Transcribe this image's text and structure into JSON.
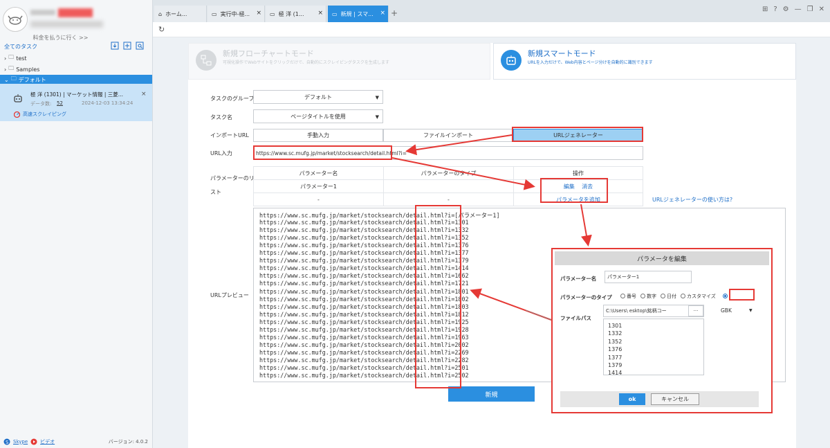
{
  "sidebar": {
    "pay_link": "料金を払うに行く >>",
    "all_tasks": "全てのタスク",
    "folders": [
      "test",
      "Samples",
      "デフォルト"
    ],
    "task": {
      "title": "極 洋 (1301) | マーケット情報 | 三菱...",
      "count_label": "データ数:",
      "count_value": "52",
      "date": "2024-12-03 13:34:24",
      "badge": "高速スクレイピング"
    },
    "footer": {
      "skype": "Skype",
      "video": "ビデオ",
      "version": "バージョン: 4.0.2"
    }
  },
  "tabs": [
    {
      "label": "ホーム...",
      "icon": "home-icon"
    },
    {
      "label": "実行中-極...",
      "icon": "page-icon"
    },
    {
      "label": "極 洋 (1...",
      "icon": "page-icon"
    },
    {
      "label": "新規 | スマ...",
      "icon": "page-icon",
      "active": true
    }
  ],
  "modes": {
    "flow": {
      "title": "新規フローチャートモード",
      "desc": "可視化操作でWebサイトをクリックだけで、自動的にスクレイピングタスクを生成します"
    },
    "smart": {
      "title": "新規スマートモード",
      "desc": "URLを入力だけで、Web内容とページ分けを自動的に識別できます"
    }
  },
  "form": {
    "group_label": "タスクのグループ",
    "group_value": "デフォルト",
    "name_label": "タスク名",
    "name_value": "ページタイトルを使用",
    "import_label": "インポートURL",
    "import_options": [
      "手動入力",
      "ファイルインポート",
      "URLジェネレーター"
    ],
    "url_label": "URL入力",
    "url_value": "https://www.sc.mufg.jp/market/stocksearch/detail.html?i=",
    "param_label_1": "パラメーターのリ",
    "param_label_2": "スト",
    "param_headers": [
      "パラメーター名",
      "パラメーターのタイプ",
      "操作"
    ],
    "param_row": {
      "name": "パラメーター1",
      "type": "",
      "edit": "編集",
      "delete": "消去"
    },
    "add_row": {
      "name": "-",
      "type": "-",
      "add": "パラメータを追加"
    },
    "help_link": "URLジェネレーターの使い方は?",
    "preview_label": "URLプレビュー",
    "new_button": "新規"
  },
  "preview": {
    "base": "https://www.sc.mufg.jp/market/stocksearch/detail.html?i=",
    "suffixes": [
      "[パラメーター1]",
      "1301",
      "1332",
      "1352",
      "1376",
      "1377",
      "1379",
      "1414",
      "1662",
      "1721",
      "1801",
      "1802",
      "1803",
      "1812",
      "1925",
      "1928",
      "1963",
      "2002",
      "2269",
      "2282",
      "2501",
      "2502"
    ]
  },
  "modal": {
    "title": "パラメータを編集",
    "name_label": "パラメーター名",
    "name_value": "パラメーター1",
    "type_label": "パラメーターのタイプ",
    "type_options": [
      "番号",
      "数字",
      "日付",
      "カスタマイズ",
      ""
    ],
    "file_label": "ファイルパス",
    "file_path": "C:\\Users\\     esktop\\銘柄コー",
    "browse": "···",
    "encoding": "GBK",
    "list": [
      "1301",
      "1332",
      "1352",
      "1376",
      "1377",
      "1379",
      "1414"
    ],
    "ok": "ok",
    "cancel": "キャンセル"
  },
  "colors": {
    "accent": "#2b8fe0",
    "annotation": "#e53935",
    "link": "#1e6fc8"
  }
}
